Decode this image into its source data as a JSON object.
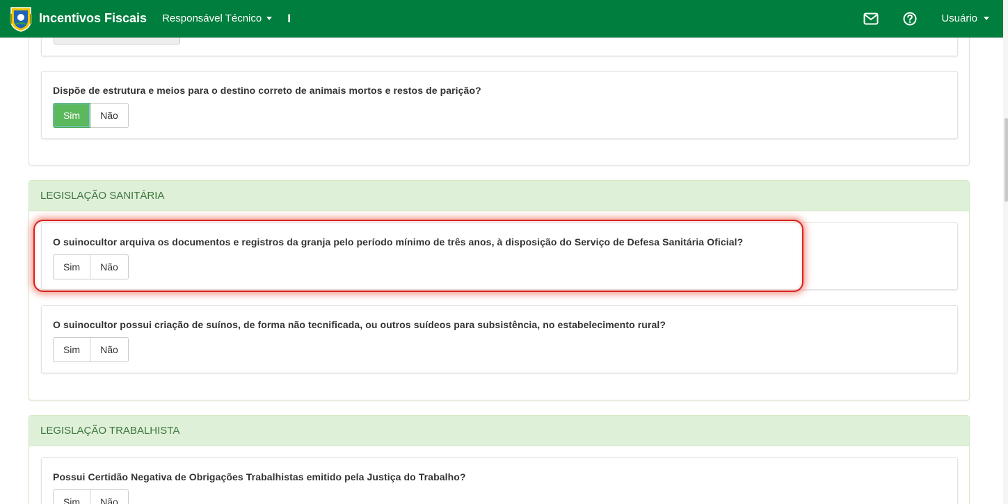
{
  "navbar": {
    "brand": "Incentivos Fiscais",
    "menu_label": "Responsável Técnico",
    "separator": "I",
    "user_label": "Usuário",
    "color": "#007e3d"
  },
  "panels": [
    {
      "questions": [
        {
          "text": "Dispõe de estrutura e meios para o destino correto de animais mortos e restos de parição?",
          "yes_label": "Sim",
          "no_label": "Não",
          "selected": "Sim"
        }
      ]
    },
    {
      "title": "LEGISLAÇÃO SANITÁRIA",
      "questions": [
        {
          "text": "O suinocultor arquiva os documentos e registros da granja pelo período mínimo de três anos, à disposição do Serviço de Defesa Sanitária Oficial?",
          "yes_label": "Sim",
          "no_label": "Não"
        },
        {
          "text": "O suinocultor possui criação de suínos, de forma não tecnificada, ou outros suídeos para subsistência, no estabelecimento rural?",
          "yes_label": "Sim",
          "no_label": "Não"
        }
      ]
    },
    {
      "title": "LEGISLAÇÃO TRABALHISTA",
      "questions": [
        {
          "text": "Possui Certidão Negativa de Obrigações Trabalhistas emitido pela Justiça do Trabalho?",
          "yes_label": "Sim",
          "no_label": "Não"
        }
      ]
    }
  ],
  "icons": [
    "state-coat-of-arms-icon",
    "mail-icon",
    "help-icon"
  ],
  "accent_colors": {
    "selected_button": "#5cb85c",
    "panel_heading_bg": "#dff0d8",
    "panel_heading_text": "#3c763d",
    "highlight_outline": "#d8211c"
  }
}
